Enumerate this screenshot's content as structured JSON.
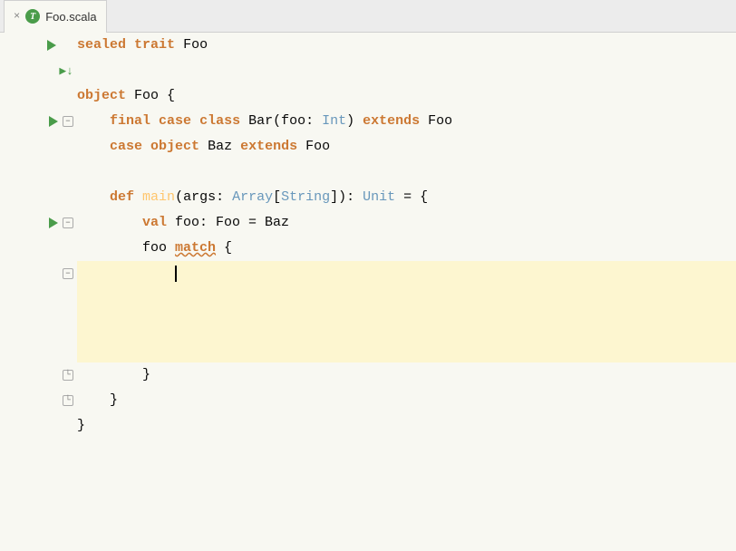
{
  "tab": {
    "close_label": "×",
    "icon_label": "T",
    "name": "Foo.scala"
  },
  "gutter": {
    "rows": [
      {
        "arrow": "run",
        "fold": null
      },
      {
        "arrow": "step",
        "fold": null
      },
      {
        "arrow": null,
        "fold": null
      },
      {
        "arrow": "run2",
        "fold": "open"
      },
      {
        "arrow": null,
        "fold": null
      },
      {
        "arrow": null,
        "fold": null
      },
      {
        "arrow": null,
        "fold": null
      },
      {
        "arrow": "run3",
        "fold": "open2"
      },
      {
        "arrow": null,
        "fold": null
      },
      {
        "arrow": null,
        "fold": "highlight"
      },
      {
        "arrow": null,
        "fold": null
      },
      {
        "arrow": null,
        "fold": null
      },
      {
        "arrow": null,
        "fold": null
      },
      {
        "arrow": null,
        "fold": null
      },
      {
        "arrow": null,
        "fold": "close2"
      },
      {
        "arrow": null,
        "fold": "close3"
      },
      {
        "arrow": null,
        "fold": null
      }
    ]
  },
  "code": {
    "lines": [
      {
        "text": "sealed trait Foo"
      },
      {
        "text": ""
      },
      {
        "text": "object Foo {"
      },
      {
        "text": "    final case class Bar(foo: Int) extends Foo"
      },
      {
        "text": "    case object Baz extends Foo"
      },
      {
        "text": ""
      },
      {
        "text": "    def main(args: Array[String]): Unit = {"
      },
      {
        "text": "        val foo: Foo = Baz"
      },
      {
        "text": "        foo match {"
      },
      {
        "text": "            |",
        "cursor": true,
        "highlighted": true
      },
      {
        "text": "",
        "highlighted": true
      },
      {
        "text": "",
        "highlighted": true
      },
      {
        "text": "",
        "highlighted": true
      },
      {
        "text": "        }"
      },
      {
        "text": "    }"
      },
      {
        "text": ""
      }
    ]
  }
}
